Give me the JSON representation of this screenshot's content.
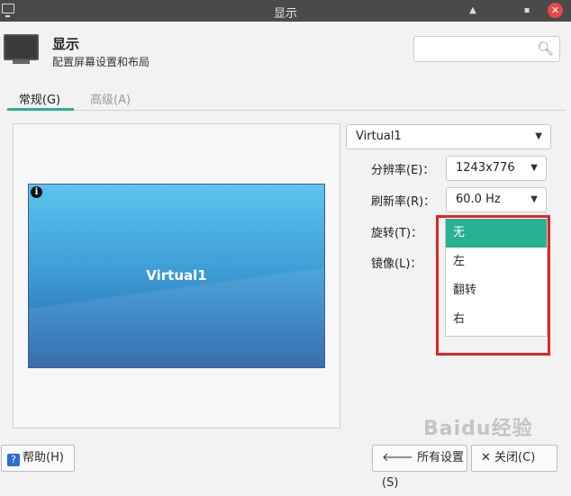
{
  "window": {
    "title": "显示"
  },
  "header": {
    "title": "显示",
    "subtitle": "配置屏幕设置和布局",
    "search_placeholder": ""
  },
  "tabs": [
    {
      "label": "常规(G)",
      "active": true
    },
    {
      "label": "高级(A)",
      "active": false
    }
  ],
  "preview": {
    "display_name": "Virtual1"
  },
  "display_select": {
    "value": "Virtual1"
  },
  "fields": {
    "resolution": {
      "label": "分辨率(E)：",
      "value": "1243x776"
    },
    "refresh": {
      "label": "刷新率(R)：",
      "value": "60.0 Hz"
    },
    "rotation": {
      "label": "旋转(T)："
    },
    "mirror": {
      "label": "镜像(L)："
    }
  },
  "rotation_menu": {
    "options": [
      "无",
      "左",
      "翻转",
      "右"
    ],
    "selected": "无"
  },
  "footer": {
    "help": "帮助(H)",
    "all_settings": "所有设置(S)",
    "close": "关闭(C)"
  },
  "watermark": "Baidu经验",
  "colors": {
    "accent": "#2ab093",
    "highlight": "#e22226",
    "titlebar": "#4a4a4a"
  }
}
